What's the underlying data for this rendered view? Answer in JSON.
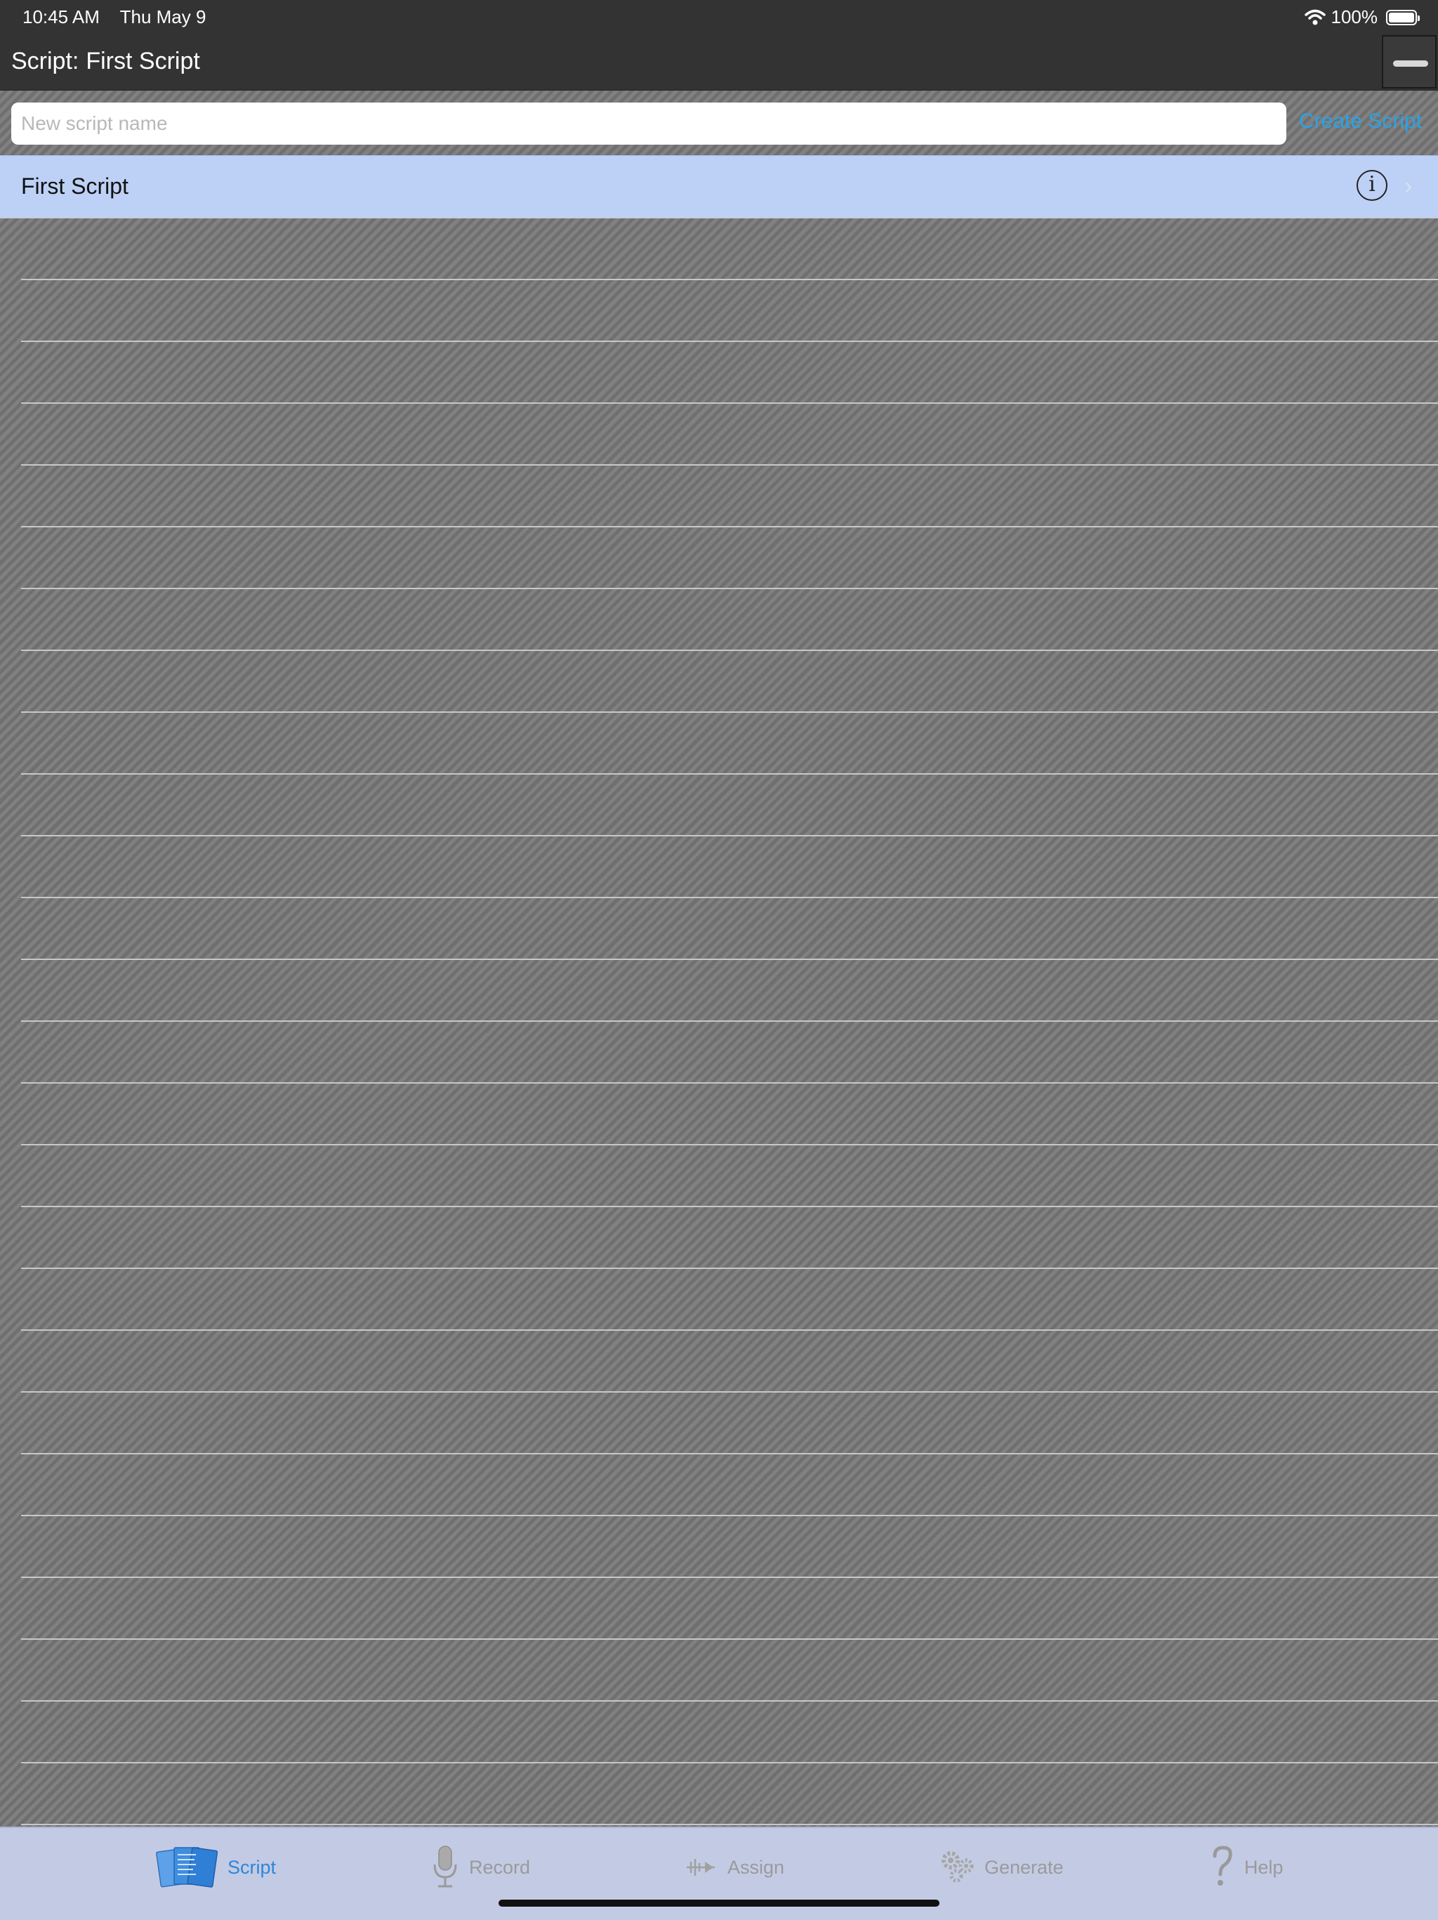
{
  "status_bar": {
    "time": "10:45 AM",
    "date": "Thu May 9",
    "battery": "100%"
  },
  "nav": {
    "label": "Script:",
    "script_name": "First Script"
  },
  "new_script": {
    "placeholder": "New script name",
    "create_label": "Create Script"
  },
  "scripts": [
    {
      "name": "First Script"
    }
  ],
  "tabs": [
    {
      "label": "Script",
      "icon": "script-pages-icon",
      "active": true
    },
    {
      "label": "Record",
      "icon": "microphone-icon",
      "active": false
    },
    {
      "label": "Assign",
      "icon": "waveform-arrow-icon",
      "active": false
    },
    {
      "label": "Generate",
      "icon": "gears-icon",
      "active": false
    },
    {
      "label": "Help",
      "icon": "question-mark-icon",
      "active": false
    }
  ],
  "colors": {
    "accent": "#2aa3e8",
    "selected_row": "#bdd0f5",
    "tab_active": "#2f86d8",
    "bar": "#333333"
  }
}
